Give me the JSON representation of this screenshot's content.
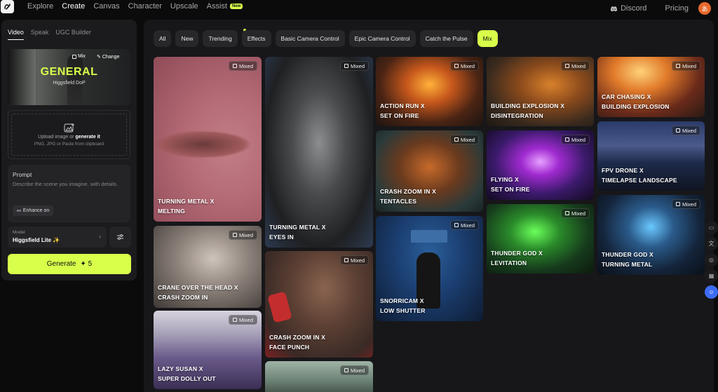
{
  "nav": {
    "items": [
      "Explore",
      "Create",
      "Canvas",
      "Character",
      "Upscale",
      "Assist"
    ],
    "active": "Create",
    "assist_badge": "New",
    "discord": "Discord",
    "pricing": "Pricing",
    "avatar_initial": "あ"
  },
  "panel": {
    "tabs": [
      "Video",
      "Speak",
      "UGC Builder"
    ],
    "preview": {
      "title": "GENERAL",
      "subtitle": "Higgsfield DoP",
      "mix": "Mix",
      "change": "Change"
    },
    "upload": {
      "line1_a": "Upload image or ",
      "line1_b": "generate it",
      "line2": "PNG, JPG or Paste from clipboard"
    },
    "prompt": {
      "label": "Prompt",
      "placeholder": "Describe the scene you imagine, with details.",
      "enhance": "Enhance on"
    },
    "model": {
      "label": "Model",
      "value": "Higgsfield Lite ✨"
    },
    "generate": {
      "label": "Generate",
      "credits": "✦ 5"
    }
  },
  "filters": [
    "All",
    "New",
    "Trending",
    "Effects",
    "Basic Camera Control",
    "Epic Camera Control",
    "Catch the Pulse",
    "Mix"
  ],
  "active_filter": "Mix",
  "mixed_label": "Mixed",
  "cards": [
    {
      "line1": "TURNING METAL X",
      "line2": "MELTING"
    },
    {
      "line1": "CRANE OVER THE HEAD X",
      "line2": "CRASH ZOOM IN"
    },
    {
      "line1": "LAZY SUSAN X",
      "line2": "SUPER DOLLY OUT"
    },
    {
      "line1": "TURNING METAL X",
      "line2": "EYES IN"
    },
    {
      "line1": "CRASH ZOOM IN X",
      "line2": "FACE PUNCH"
    },
    {
      "line1": "",
      "line2": ""
    },
    {
      "line1": "ACTION RUN X",
      "line2": "SET ON FIRE"
    },
    {
      "line1": "CRASH ZOOM IN X",
      "line2": "TENTACLES"
    },
    {
      "line1": "SNORRICAM X",
      "line2": "LOW SHUTTER"
    },
    {
      "line1": "BUILDING EXPLOSION X",
      "line2": "DISINTEGRATION"
    },
    {
      "line1": "FLYING X",
      "line2": "SET ON FIRE"
    },
    {
      "line1": "THUNDER GOD X",
      "line2": "LEVITATION"
    },
    {
      "line1": "CAR CHASING X",
      "line2": "BUILDING EXPLOSION"
    },
    {
      "line1": "FPV DRONE X",
      "line2": "TIMELAPSE LANDSCAPE"
    },
    {
      "line1": "THUNDER GOD X",
      "line2": "TURNING METAL"
    }
  ],
  "colors": {
    "accent": "#d8ff4a",
    "background": "#0b0b0c",
    "panel": "#1b1b1d"
  }
}
